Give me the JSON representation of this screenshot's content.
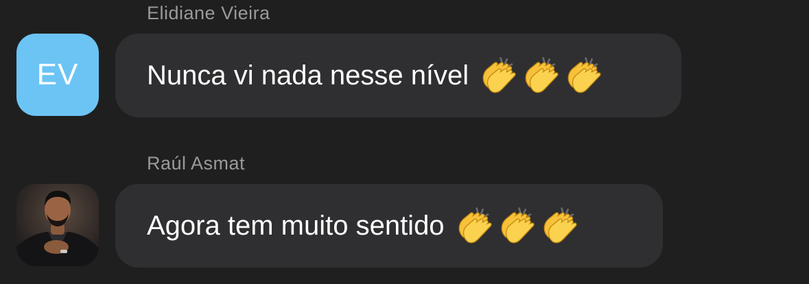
{
  "messages": [
    {
      "sender": "Elidiane Vieira",
      "avatar_initials": "EV",
      "avatar_color": "#6cc4f5",
      "text": "Nunca vi nada nesse nível",
      "emoji": "clapping-hands-icon",
      "emoji_count": 3
    },
    {
      "sender": "Raúl Asmat",
      "avatar_type": "photo",
      "text": "Agora tem muito sentido",
      "emoji": "clapping-hands-icon",
      "emoji_count": 3
    }
  ],
  "colors": {
    "background": "#1f1f20",
    "bubble": "#2f2f31",
    "sender_name": "#9a9a9c",
    "message_text": "#ffffff"
  }
}
